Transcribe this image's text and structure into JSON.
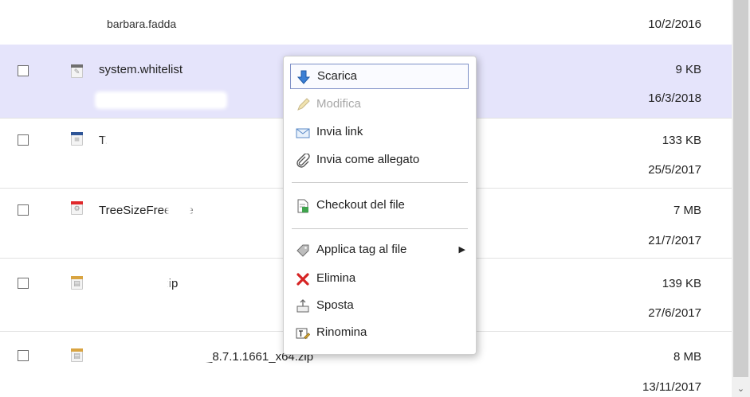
{
  "files": [
    {
      "name": "",
      "owner": "barbara.fadda",
      "size": "",
      "date": "10/2/2016",
      "icon": "none",
      "selected": false
    },
    {
      "name": "system.whitelist",
      "owner": "",
      "size": "9 KB",
      "date": "16/3/2018",
      "icon": "paperclip-file-icon",
      "selected": true
    },
    {
      "name": "T.pdf",
      "owner": "",
      "size": "133 KB",
      "date": "25/5/2017",
      "icon": "pdf-file-icon",
      "selected": false
    },
    {
      "name": "TreeSizeFree.exe",
      "owner": "",
      "size": "7 MB",
      "date": "21/7/2017",
      "icon": "exe-file-icon",
      "selected": false
    },
    {
      "name": ".zip",
      "owner": "",
      "size": "139 KB",
      "date": "27/6/2017",
      "icon": "zip-file-icon",
      "selected": false
    },
    {
      "name": "_8.7.1.1661_x64.zip",
      "owner": "",
      "size": "8 MB",
      "date": "13/11/2017",
      "icon": "zip-file-icon",
      "selected": false
    }
  ],
  "context_menu": {
    "items": [
      {
        "label": "Scarica",
        "icon": "download-arrow-icon",
        "highlighted": true,
        "disabled": false
      },
      {
        "label": "Modifica",
        "icon": "pencil-icon",
        "highlighted": false,
        "disabled": true
      },
      {
        "label": "Invia link",
        "icon": "envelope-icon",
        "highlighted": false,
        "disabled": false
      },
      {
        "label": "Invia come allegato",
        "icon": "paperclip-icon",
        "highlighted": false,
        "disabled": false
      },
      {
        "label": "Checkout del file",
        "icon": "checkout-document-icon",
        "highlighted": false,
        "disabled": false
      },
      {
        "label": "Applica tag al file",
        "icon": "tag-icon",
        "highlighted": false,
        "disabled": false,
        "submenu": true
      },
      {
        "label": "Elimina",
        "icon": "red-x-icon",
        "highlighted": false,
        "disabled": false
      },
      {
        "label": "Sposta",
        "icon": "move-icon",
        "highlighted": false,
        "disabled": false
      },
      {
        "label": "Rinomina",
        "icon": "rename-icon",
        "highlighted": false,
        "disabled": false
      }
    ],
    "submenu_arrow": "▶"
  },
  "scrollbar": {
    "down_arrow": "⌄"
  },
  "colors": {
    "selected_row": "#e5e4fb",
    "menu_highlight_border": "#7d8fc6",
    "pdf_band": "#2f5597",
    "exe_band": "#e0292b",
    "zip_band": "#d9a441",
    "clip_band": "#6f6f6f"
  }
}
